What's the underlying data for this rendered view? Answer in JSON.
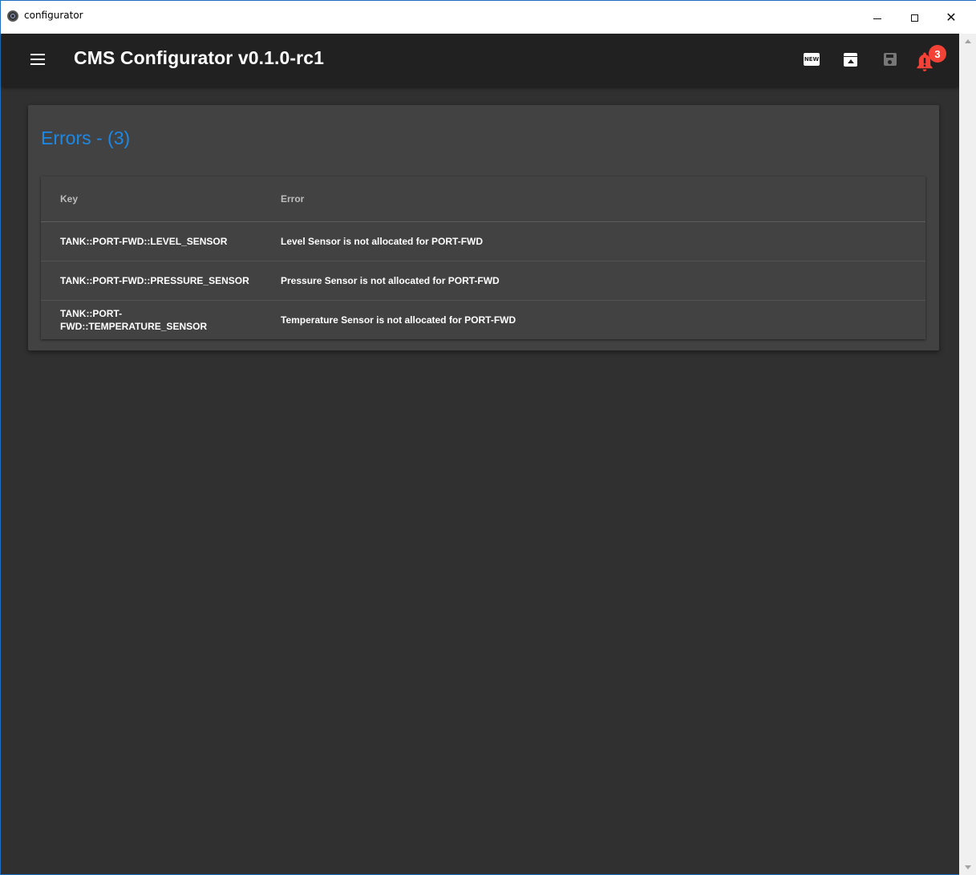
{
  "window": {
    "title": "configurator"
  },
  "appbar": {
    "title": "CMS Configurator v0.1.0-rc1",
    "new_icon_label": "NEW",
    "notification_count": "3"
  },
  "card": {
    "title": "Errors - (3)",
    "columns": {
      "key": "Key",
      "error": "Error"
    },
    "rows": [
      {
        "key": "TANK::PORT-FWD::LEVEL_SENSOR",
        "error": "Level Sensor is not allocated for PORT-FWD"
      },
      {
        "key": "TANK::PORT-FWD::PRESSURE_SENSOR",
        "error": "Pressure Sensor is not allocated for PORT-FWD"
      },
      {
        "key": "TANK::PORT-FWD::TEMPERATURE_SENSOR",
        "error": "Temperature Sensor is not allocated for PORT-FWD"
      }
    ]
  },
  "colors": {
    "background": "#303030",
    "appbar": "#212121",
    "card": "#424242",
    "title_accent": "#1e88e5",
    "badge": "#f44336"
  },
  "icons": [
    "app-icon",
    "menu-icon",
    "new-icon",
    "archive-icon",
    "save-icon",
    "bell-alert-icon"
  ]
}
